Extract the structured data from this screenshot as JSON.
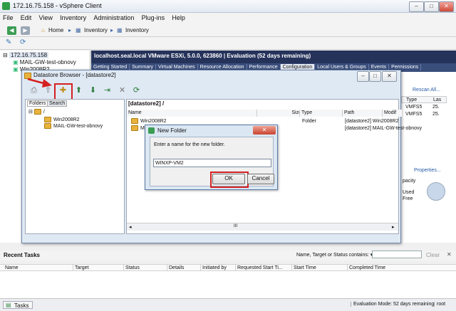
{
  "window": {
    "title": "172.16.75.158 - vSphere Client",
    "minimize": "–",
    "maximize": "□",
    "close": "✕"
  },
  "menu": [
    "File",
    "Edit",
    "View",
    "Inventory",
    "Administration",
    "Plug-ins",
    "Help"
  ],
  "nav": {
    "home": "Home",
    "crumbs": [
      "Inventory",
      "Inventory"
    ]
  },
  "tree": [
    {
      "label": "172.16.75.158"
    },
    {
      "label": "MAIL-GW-test-obnovy"
    },
    {
      "label": "Win2008R2"
    }
  ],
  "host_header": "localhost.seal.local VMware ESXi, 5.0.0, 623860 | Evaluation (52 days remaining)",
  "tabs": [
    "Getting Started",
    "Summary",
    "Virtual Machines",
    "Resource Allocation",
    "Performance",
    "Configuration",
    "Local Users & Groups",
    "Events",
    "Permissions"
  ],
  "active_tab": "Configuration",
  "right_panel": {
    "rescan": "Rescan All...",
    "cols": [
      "Type",
      "Las"
    ],
    "rows": [
      [
        "VMFS5",
        "25."
      ],
      [
        "VMFS5",
        "25."
      ]
    ],
    "properties": "Properties...",
    "capacity": "pacity",
    "used": "Used",
    "free": "Free"
  },
  "ds": {
    "title": "Datastore Browser - [datastore2]",
    "tabs": [
      "Folders",
      "Search"
    ],
    "root": "/",
    "folders": [
      "Win2008R2",
      "MAIL-GW-test-obnovy"
    ],
    "path": "[datastore2] /",
    "cols": [
      "Name",
      "Size",
      "Type",
      "Path",
      "Modif"
    ],
    "rows": [
      {
        "name": "Win2008R2",
        "type": "Folder",
        "path": "[datastore2] Win2008R2"
      },
      {
        "name": "M",
        "type": "",
        "path": "[datastore2] MAIL-GW-test-obnovy"
      }
    ],
    "scroll": "III"
  },
  "dialog": {
    "title": "New Folder",
    "close": "✕",
    "prompt": "Enter a name for the new folder.",
    "value": "WINXP-VM2",
    "ok": "OK",
    "cancel": "Cancel"
  },
  "recent_tasks": {
    "title": "Recent Tasks",
    "filter_label": "Name, Target or Status contains: ▾",
    "clear": "Clear",
    "close": "✕",
    "cols": [
      "Name",
      "Target",
      "Status",
      "Details",
      "Initiated by",
      "Requested Start Ti...",
      "Start Time",
      "Completed Time"
    ]
  },
  "status": {
    "tasks": "Tasks",
    "evaluation": "Evaluation Mode: 52 days remaining",
    "user": "root"
  }
}
